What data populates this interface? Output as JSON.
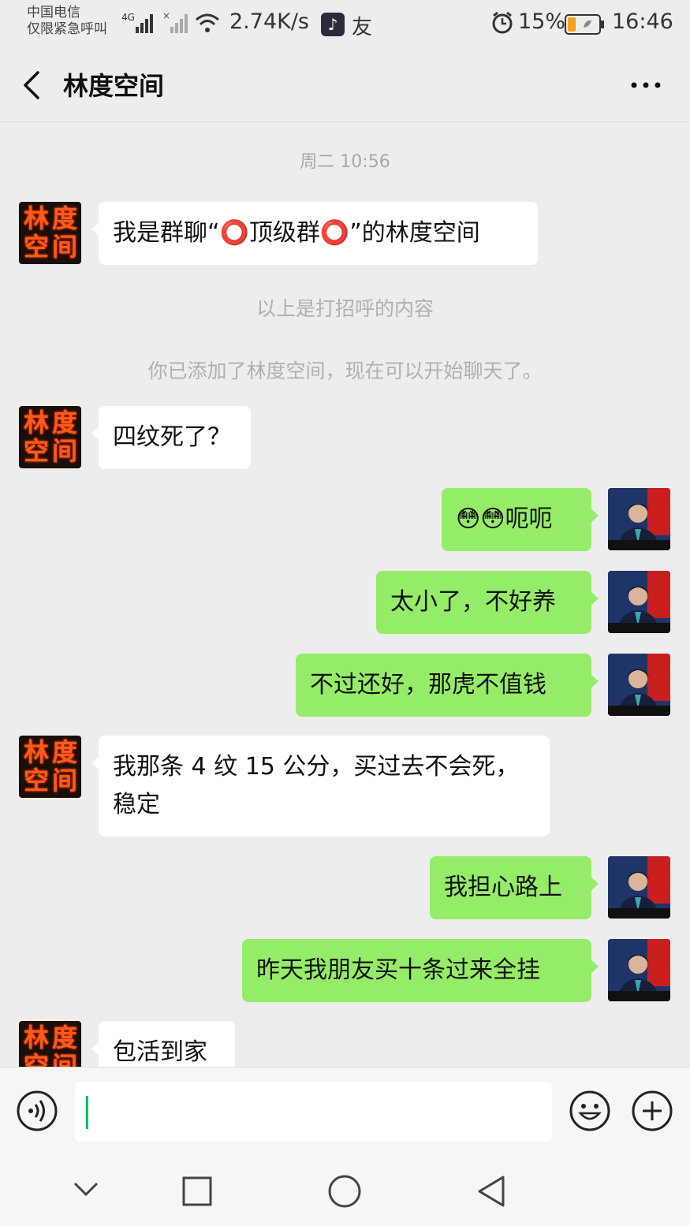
{
  "status_bar": {
    "carrier_line1": "中国电信",
    "carrier_line2": "仅限紧急呼叫",
    "network": "4G",
    "speed": "2.74K/s",
    "app_badge": "友",
    "battery_pct": "15%",
    "time": "16:46"
  },
  "header": {
    "title": "林度空间",
    "back_icon": "chevron-left-icon",
    "more_icon": "more-dots-icon"
  },
  "chat": {
    "timestamp": "周二 10:56",
    "system_1": "以上是打招呼的内容",
    "system_2": "你已添加了林度空间，现在可以开始聊天了。",
    "contact_avatar_text": [
      "林",
      "度",
      "空",
      "间"
    ],
    "messages": [
      {
        "side": "left",
        "text": "我是群聊“⭕顶级群⭕”的林度空间"
      },
      {
        "side": "left",
        "text": "四纹死了？"
      },
      {
        "side": "right",
        "text": "😳😳呃呃"
      },
      {
        "side": "right",
        "text": "太小了，不好养"
      },
      {
        "side": "right",
        "text": "不过还好，那虎不值钱"
      },
      {
        "side": "left",
        "text": "我那条 4 纹 15 公分，买过去不会死，稳定"
      },
      {
        "side": "right",
        "text": "我担心路上"
      },
      {
        "side": "right",
        "text": "昨天我朋友买十条过来全挂"
      },
      {
        "side": "left",
        "text": "包活到家"
      }
    ]
  },
  "input_bar": {
    "voice_icon": "voice-icon",
    "emoji_icon": "emoji-icon",
    "add_icon": "plus-circle-icon",
    "value": ""
  },
  "nav_bar": {
    "icons": [
      "nav-back-chevron-icon",
      "recent-apps-square-icon",
      "home-circle-icon",
      "back-triangle-icon"
    ]
  },
  "colors": {
    "background": "#ededed",
    "self_bubble": "#95ec69",
    "other_bubble": "#ffffff",
    "accent": "#07c160"
  }
}
